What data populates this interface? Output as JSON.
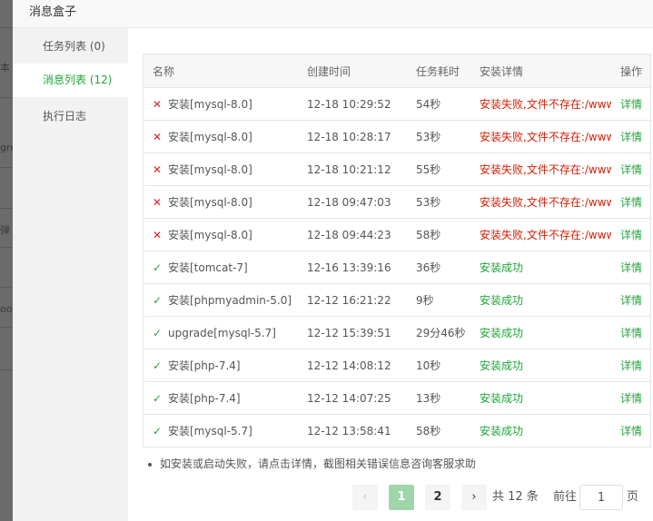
{
  "dialog": {
    "title": "消息盒子"
  },
  "background": {
    "fragments": [
      "本",
      "gre",
      "弹",
      "oo"
    ]
  },
  "sidebar": {
    "items": [
      {
        "label": "任务列表 (0)",
        "active": false
      },
      {
        "label": "消息列表 (12)",
        "active": true
      },
      {
        "label": "执行日志",
        "active": false
      }
    ]
  },
  "table": {
    "headers": [
      "名称",
      "创建时间",
      "任务耗时",
      "安装详情",
      "操作"
    ],
    "rows": [
      {
        "status": "fail",
        "name": "安装[mysql-8.0]",
        "time": "12-18 10:29:52",
        "duration": "54秒",
        "detail": "安装失败,文件不存在:/www/server/panel/install/mysql.sh",
        "action": "详情"
      },
      {
        "status": "fail",
        "name": "安装[mysql-8.0]",
        "time": "12-18 10:28:17",
        "duration": "53秒",
        "detail": "安装失败,文件不存在:/www/server/panel/install/mysql.sh",
        "action": "详情"
      },
      {
        "status": "fail",
        "name": "安装[mysql-8.0]",
        "time": "12-18 10:21:12",
        "duration": "55秒",
        "detail": "安装失败,文件不存在:/www/server/panel/install/mysql.sh",
        "action": "详情"
      },
      {
        "status": "fail",
        "name": "安装[mysql-8.0]",
        "time": "12-18 09:47:03",
        "duration": "53秒",
        "detail": "安装失败,文件不存在:/www/server/panel/install/mysql.sh",
        "action": "详情"
      },
      {
        "status": "fail",
        "name": "安装[mysql-8.0]",
        "time": "12-18 09:44:23",
        "duration": "58秒",
        "detail": "安装失败,文件不存在:/www/server/panel/install/mysql.sh",
        "action": "详情"
      },
      {
        "status": "ok",
        "name": "安装[tomcat-7]",
        "time": "12-16 13:39:16",
        "duration": "36秒",
        "detail": "安装成功",
        "action": "详情"
      },
      {
        "status": "ok",
        "name": "安装[phpmyadmin-5.0]",
        "time": "12-12 16:21:22",
        "duration": "9秒",
        "detail": "安装成功",
        "action": "详情"
      },
      {
        "status": "ok",
        "name": "upgrade[mysql-5.7]",
        "time": "12-12 15:39:51",
        "duration": "29分46秒",
        "detail": "安装成功",
        "action": "详情"
      },
      {
        "status": "ok",
        "name": "安装[php-7.4]",
        "time": "12-12 14:08:12",
        "duration": "10秒",
        "detail": "安装成功",
        "action": "详情"
      },
      {
        "status": "ok",
        "name": "安装[php-7.4]",
        "time": "12-12 14:07:25",
        "duration": "13秒",
        "detail": "安装成功",
        "action": "详情"
      },
      {
        "status": "ok",
        "name": "安装[mysql-5.7]",
        "time": "12-12 13:58:41",
        "duration": "58秒",
        "detail": "安装成功",
        "action": "详情"
      }
    ]
  },
  "note": "如安装或启动失败，请点击详情，截图相关错误信息咨询客服求助",
  "pagination": {
    "prev_icon": "chevron-left-icon",
    "next_icon": "chevron-right-icon",
    "prev": "‹",
    "next": "›",
    "pages": [
      "1",
      "2"
    ],
    "current": "1",
    "total": "共 12 条",
    "goto_label": "前往",
    "goto_value": "1",
    "page_unit": "页"
  },
  "colors": {
    "accent": "#20a53a",
    "fail": "#e02020",
    "fail_detail": "#d81e06",
    "active_page": "#9fd6a9"
  },
  "icons": {
    "fail": "cross-icon",
    "ok": "check-icon"
  }
}
